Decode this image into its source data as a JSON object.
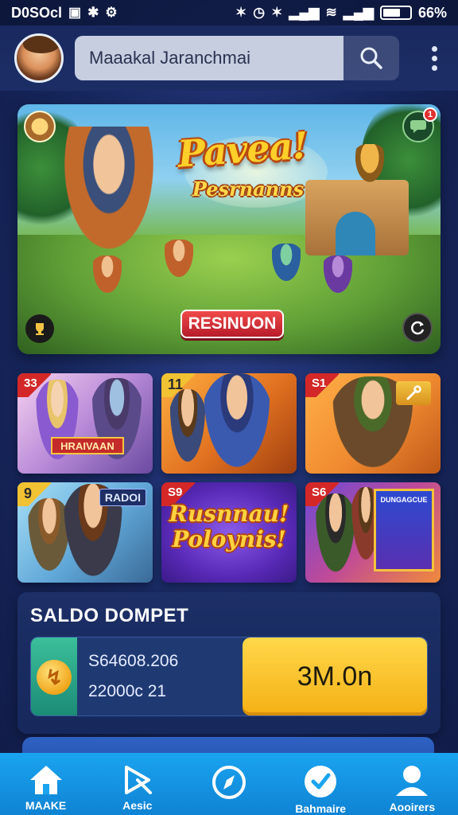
{
  "status_bar": {
    "time": "D0SOсl",
    "battery_text": "66%",
    "battery_level": 0.66
  },
  "header": {
    "search": {
      "value": "Maaakal Jaranchmai",
      "icon": "search-icon"
    },
    "menu_icon": "kebab-menu-icon",
    "avatar_icon": "user-avatar"
  },
  "hero": {
    "title": "Pavea!",
    "subtitle": "Pesrnanns",
    "cta_label": "RESINUON",
    "notification_count": "1"
  },
  "game_cards": [
    {
      "badge": "33",
      "banner": "HRAIVAAN"
    },
    {
      "badge": "11"
    },
    {
      "badge": "S1"
    },
    {
      "badge": "9",
      "tag": "RADOI"
    },
    {
      "badge": "S9",
      "headline": "Rusnnau! Poloynis!"
    },
    {
      "badge": "S6",
      "promo_text": "DUNGAGCUE"
    }
  ],
  "wallet": {
    "title": "SALDO DOMPET",
    "value_1": "S64608.206",
    "value_2": "22000c 21",
    "topup_label": "3M.0n"
  },
  "bottom_nav": [
    {
      "label": "MAAKE",
      "icon": "home-icon"
    },
    {
      "label": "Aesic",
      "icon": "play-arrow-icon"
    },
    {
      "label": "",
      "icon": "compass-icon"
    },
    {
      "label": "Bahmaire",
      "icon": "shield-check-icon"
    },
    {
      "label": "Aooirers",
      "icon": "profile-icon"
    }
  ],
  "colors": {
    "background": "#17275e",
    "accent_yellow": "#ffd84a",
    "nav_blue": "#1aa4f0",
    "cta_red": "#d42727"
  }
}
